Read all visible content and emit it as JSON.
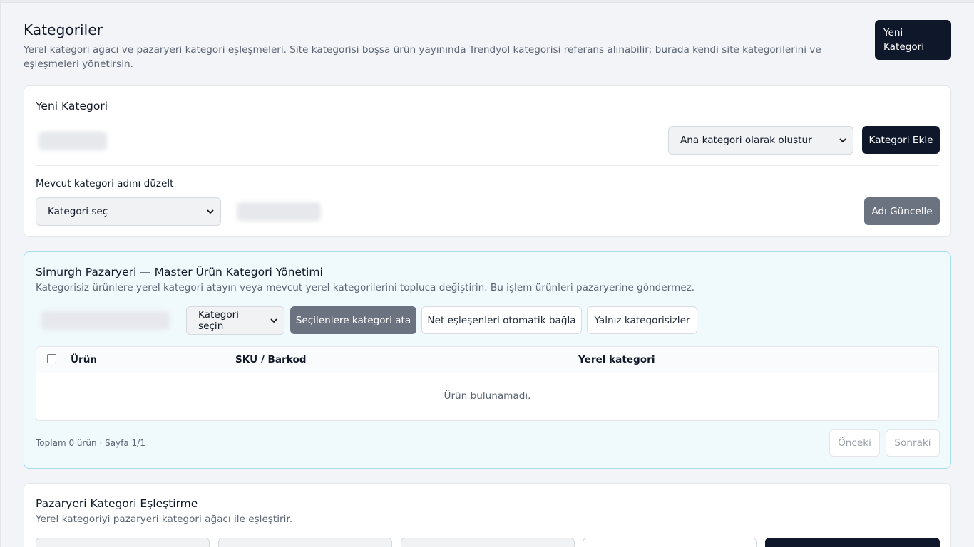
{
  "header": {
    "title": "Kategoriler",
    "description": "Yerel kategori ağacı ve pazaryeri kategori eşleşmeleri. Site kategorisi boşsa ürün yayınında Trendyol kategorisi referans alınabilir; burada kendi site kategorilerini ve eşleşmeleri yönetirsin.",
    "new_category_button": "Yeni Kategori"
  },
  "new_category_card": {
    "title": "Yeni Kategori",
    "parent_select_value": "Ana kategori olarak oluştur",
    "add_button": "Kategori Ekle",
    "rename_label": "Mevcut kategori adını düzelt",
    "category_select_value": "Kategori seç",
    "update_button": "Adı Güncelle"
  },
  "master_card": {
    "title": "Simurgh Pazaryeri — Master Ürün Kategori Yönetimi",
    "subtitle": "Kategorisiz ürünlere yerel kategori atayın veya mevcut yerel kategorilerini topluca değiştirin. Bu işlem ürünleri pazaryerine göndermez.",
    "category_select_value": "Kategori seçin",
    "assign_button": "Seçilenlere kategori ata",
    "auto_link_button": "Net eşleşenleri otomatik bağla",
    "only_uncategorized_button": "Yalnız kategorisizler",
    "table": {
      "headers": [
        "Ürün",
        "SKU / Barkod",
        "Yerel kategori"
      ],
      "empty_message": "Ürün bulunamadı."
    },
    "footer_text": "Toplam 0 ürün · Sayfa 1/1",
    "prev_button": "Önceki",
    "next_button": "Sonraki"
  },
  "mapping_card": {
    "title": "Pazaryeri Kategori Eşleştirme",
    "subtitle": "Yerel kategoriyi pazaryeri kategori ağacı ile eşleştirir."
  },
  "icons": {
    "select_chevron": "chevron-down-icon"
  },
  "colors": {
    "primary_dark": "#0f172a",
    "muted_button": "#6b7280",
    "info_card_bg": "#f0f9fc",
    "info_card_border": "#a8e0ea"
  }
}
